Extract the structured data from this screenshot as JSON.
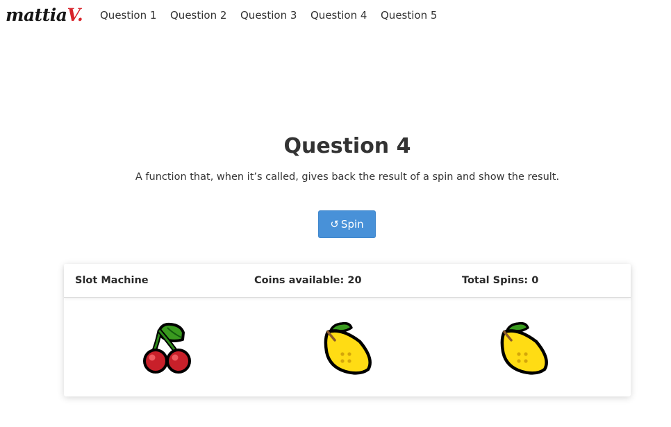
{
  "brand": {
    "part1": "mattia",
    "part2": "V."
  },
  "nav": {
    "items": [
      {
        "label": "Question 1"
      },
      {
        "label": "Question 2"
      },
      {
        "label": "Question 3"
      },
      {
        "label": "Question 4"
      },
      {
        "label": "Question 5"
      }
    ]
  },
  "main": {
    "title": "Question 4",
    "description": "A function that, when it’s called, gives back the result of a spin and show the result.",
    "spin_button": {
      "icon": "↺",
      "label": "Spin"
    }
  },
  "slot_machine": {
    "title": "Slot Machine",
    "coins_text": "Coins available: 20",
    "spins_text": "Total Spins: 0",
    "reels": [
      {
        "symbol": "cherries-icon"
      },
      {
        "symbol": "lemon-icon"
      },
      {
        "symbol": "lemon-icon"
      }
    ]
  },
  "colors": {
    "primary_button": "#4891d8",
    "brand_accent": "#d8232a",
    "text": "#333333"
  }
}
